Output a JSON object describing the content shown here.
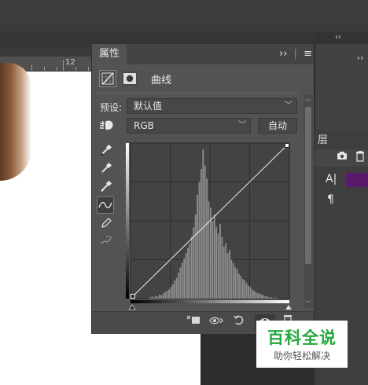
{
  "properties_panel": {
    "tab_label": "属性",
    "adjustment_title": "曲线",
    "preset_label": "预设:",
    "preset_value": "默认值",
    "channel_value": "RGB",
    "auto_button": "自动"
  },
  "ruler": {
    "tick_label": "12"
  },
  "layers_panel": {
    "title_fragment": "层",
    "text_tool": "A|",
    "paragraph": "¶"
  },
  "watermark": {
    "title": "百科全说",
    "subtitle": "助你轻松解决"
  },
  "chart_data": {
    "type": "area",
    "title": "",
    "xlabel": "",
    "ylabel": "",
    "x_range": [
      0,
      255
    ],
    "y_range": [
      0,
      255
    ],
    "grid": true,
    "series": [
      {
        "values": [
          0,
          0,
          0,
          0,
          0,
          0,
          0,
          0,
          0,
          0,
          2,
          3,
          2,
          4,
          3,
          6,
          5,
          8,
          10,
          12,
          14,
          18,
          22,
          28,
          32,
          40,
          48,
          55,
          62,
          70,
          78,
          85,
          96,
          110,
          130,
          160,
          180,
          200,
          230,
          205,
          185,
          150,
          140,
          120,
          130,
          110,
          100,
          115,
          95,
          80,
          85,
          70,
          75,
          60,
          55,
          48,
          45,
          38,
          35,
          30,
          28,
          24,
          20,
          18,
          14,
          12,
          10,
          8,
          8,
          6,
          5,
          4,
          3,
          2,
          2,
          1,
          1,
          1,
          0,
          0,
          0,
          0,
          0,
          0
        ]
      }
    ],
    "curve_points": [
      [
        0,
        0
      ],
      [
        255,
        255
      ]
    ]
  }
}
